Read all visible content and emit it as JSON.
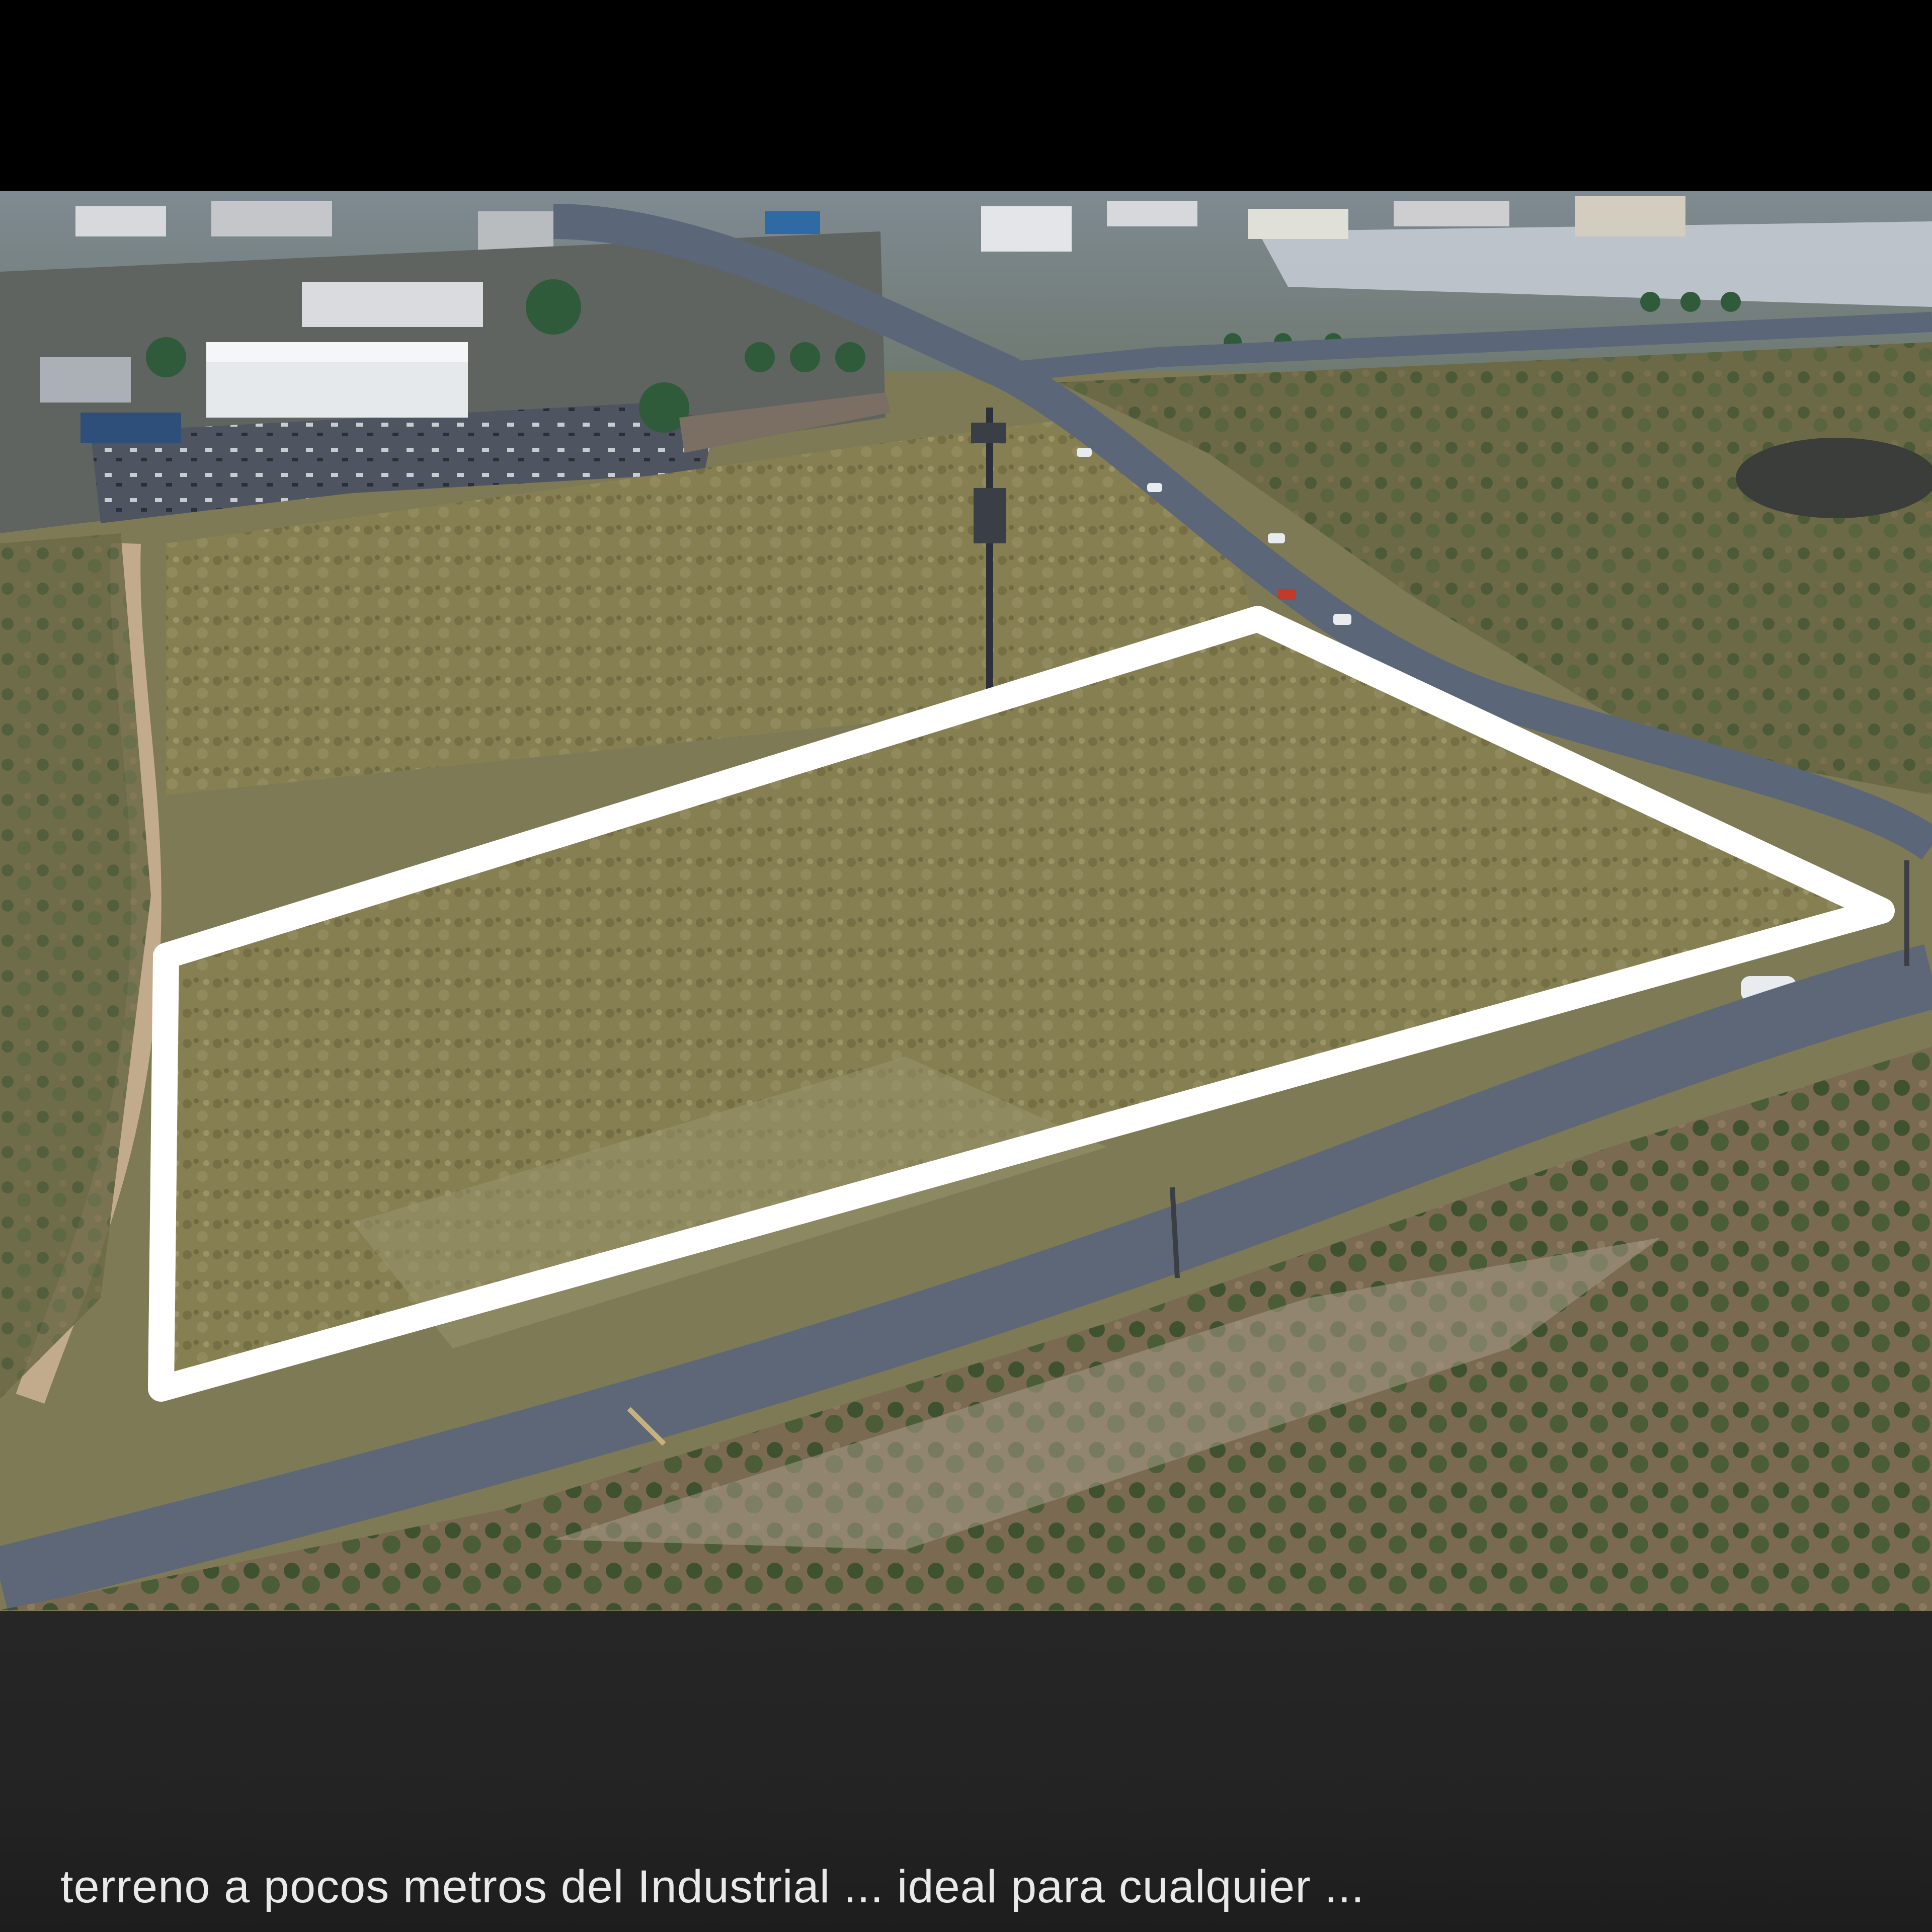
{
  "video_frame": {
    "scene": "aerial-view",
    "colors": {
      "letterbox": "#000000",
      "caption_band": "#232323",
      "outline": "#ffffff",
      "grass": "#8a8453",
      "road": "#5b6678"
    }
  },
  "caption": {
    "text": "terreno a pocos metros del Industrial ... ideal para cualquier ..."
  }
}
